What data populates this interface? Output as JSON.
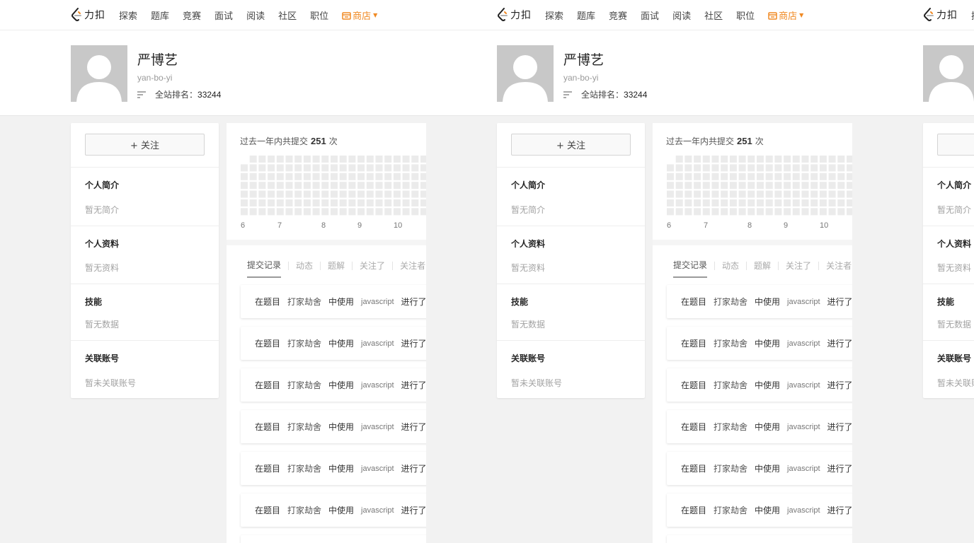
{
  "nav": {
    "logo_text": "力扣",
    "items": [
      "探索",
      "题库",
      "竞赛",
      "面试",
      "阅读",
      "社区",
      "职位"
    ],
    "store_label": "商店",
    "store_color": "#f08a24"
  },
  "profile": {
    "name": "严博艺",
    "slug": "yan-bo-yi",
    "rank_label": "全站排名：",
    "rank_value": "33244"
  },
  "sidebar": {
    "follow_label": "+ 关注",
    "sections": [
      {
        "title": "个人简介",
        "body": "暂无简介"
      },
      {
        "title": "个人资料",
        "body": "暂无资料"
      },
      {
        "title": "技能",
        "body": "暂无数据"
      },
      {
        "title": "关联账号",
        "body": "暂未关联账号"
      }
    ]
  },
  "submissions": {
    "prefix": "过去一年内共提交",
    "count": "251",
    "suffix": "次",
    "months": [
      "6",
      "7",
      "8",
      "9",
      "10"
    ]
  },
  "tabs": [
    "提交记录",
    "动态",
    "题解",
    "关注了",
    "关注者"
  ],
  "feed": {
    "rows": [
      {
        "a": "在题目",
        "problem": "打家劫舍",
        "b": "中使用",
        "lang": "javascript",
        "c": "进行了"
      },
      {
        "a": "在题目",
        "problem": "打家劫舍",
        "b": "中使用",
        "lang": "javascript",
        "c": "进行了"
      },
      {
        "a": "在题目",
        "problem": "打家劫舍",
        "b": "中使用",
        "lang": "javascript",
        "c": "进行了"
      },
      {
        "a": "在题目",
        "problem": "打家劫舍",
        "b": "中使用",
        "lang": "javascript",
        "c": "进行了"
      },
      {
        "a": "在题目",
        "problem": "打家劫舍",
        "b": "中使用",
        "lang": "javascript",
        "c": "进行了"
      },
      {
        "a": "在题目",
        "problem": "打家劫舍",
        "b": "中使用",
        "lang": "javascript",
        "c": "进行了"
      }
    ]
  }
}
